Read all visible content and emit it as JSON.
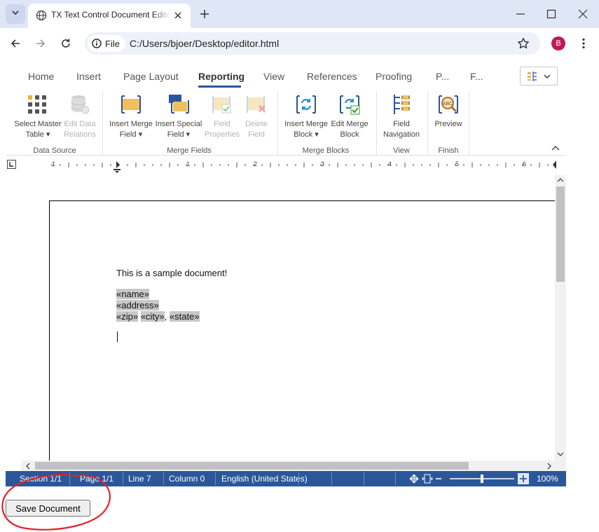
{
  "browser": {
    "tab_title": "TX Text Control Document Editor",
    "site_info": "File",
    "url": "C:/Users/bjoer/Desktop/editor.html",
    "profile_initial": "B"
  },
  "ribbon": {
    "tabs": [
      "Home",
      "Insert",
      "Page Layout",
      "Reporting",
      "View",
      "References",
      "Proofing",
      "P...",
      "F..."
    ],
    "active_tab": "Reporting",
    "groups": {
      "data_source": {
        "label": "Data Source",
        "select_master": [
          "Select Master",
          "Table ▾"
        ],
        "edit_relations": [
          "Edit Data",
          "Relations"
        ]
      },
      "merge_fields": {
        "label": "Merge Fields",
        "insert_merge_field": [
          "Insert Merge",
          "Field ▾"
        ],
        "insert_special_field": [
          "Insert Special",
          "Field ▾"
        ],
        "field_properties": [
          "Field",
          "Properties"
        ],
        "delete_field": [
          "Delete",
          "Field"
        ]
      },
      "merge_blocks": {
        "label": "Merge Blocks",
        "insert_merge_block": [
          "Insert Merge",
          "Block ▾"
        ],
        "edit_merge_block": [
          "Edit Merge",
          "Block"
        ]
      },
      "view": {
        "label": "View",
        "field_navigation": [
          "Field",
          "Navigation"
        ]
      },
      "finish": {
        "label": "Finish",
        "preview": [
          "Preview"
        ]
      }
    }
  },
  "ruler": {
    "marks": [
      "1",
      "1",
      "2",
      "3",
      "4",
      "5",
      "6"
    ]
  },
  "document": {
    "line1": "This is a sample document!",
    "field_name": "«name»",
    "field_address": "«address»",
    "field_zip": "«zip»",
    "field_city": "«city»",
    "sep_comma": ",",
    "field_state": "«state»"
  },
  "statusbar": {
    "section": "Section 1/1",
    "page": "Page 1/1",
    "line": "Line 7",
    "column": "Column 0",
    "language": "English (United States)",
    "zoom": "100%",
    "zoom_level": 0.5
  },
  "save_button": "Save Document",
  "colors": {
    "statusbar": "#2b579a",
    "accent": "#2b579a",
    "annotation": "#e0242b"
  },
  "icons": [
    "chevron-down-icon",
    "globe-icon",
    "close-icon",
    "plus-icon",
    "minimize-icon",
    "maximize-icon",
    "back-arrow-icon",
    "forward-arrow-icon",
    "reload-icon",
    "info-icon",
    "star-icon",
    "kebab-menu-icon"
  ]
}
